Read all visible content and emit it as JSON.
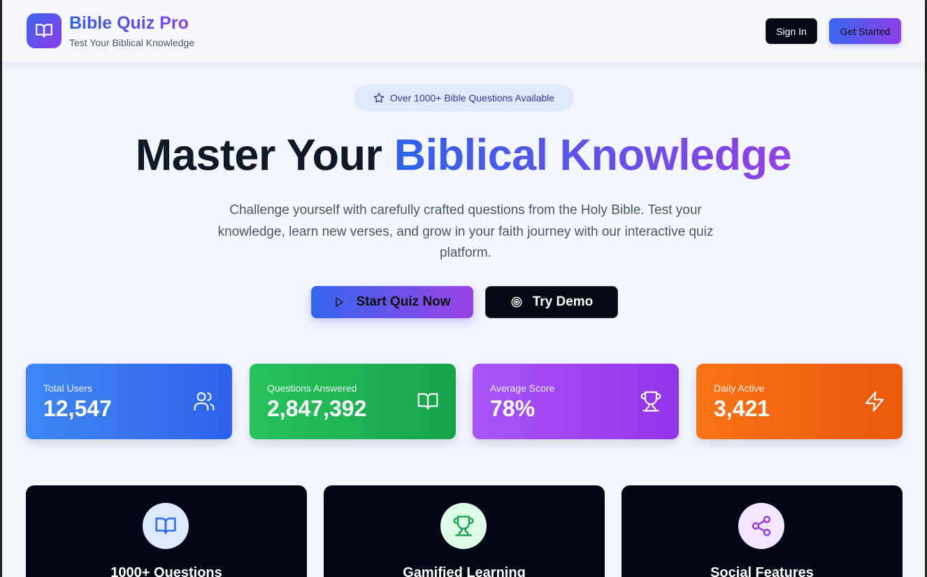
{
  "header": {
    "title": "Bible Quiz Pro",
    "subtitle": "Test Your Biblical Knowledge",
    "logo_icon": "book-open-icon",
    "sign_in_label": "Sign In",
    "get_started_label": "Get Started"
  },
  "hero": {
    "badge_text": "Over 1000+ Bible Questions Available",
    "badge_icon": "star-icon",
    "title_dark": "Master Your",
    "title_gradient": "Biblical Knowledge",
    "description": "Challenge yourself with carefully crafted questions from the Holy Bible. Test your knowledge, learn new verses, and grow in your faith journey with our interactive quiz platform.",
    "start_label": "Start Quiz Now",
    "start_icon": "play-icon",
    "demo_label": "Try Demo",
    "demo_icon": "target-icon"
  },
  "stats": [
    {
      "label": "Total Users",
      "value": "12,547",
      "icon": "users-icon",
      "color": "#3b82f6"
    },
    {
      "label": "Questions Answered",
      "value": "2,847,392",
      "icon": "book-open-icon",
      "color": "#22c55e"
    },
    {
      "label": "Average Score",
      "value": "78%",
      "icon": "trophy-icon",
      "color": "#a855f7"
    },
    {
      "label": "Daily Active",
      "value": "3,421",
      "icon": "zap-icon",
      "color": "#f97316"
    }
  ],
  "features": [
    {
      "title": "1000+ Questions",
      "icon": "book-open-icon",
      "icon_color": "#2563eb"
    },
    {
      "title": "Gamified Learning",
      "icon": "trophy-icon",
      "icon_color": "#16a34a"
    },
    {
      "title": "Social Features",
      "icon": "share-icon",
      "icon_color": "#9333ea"
    }
  ],
  "colors": {
    "accent_blue": "#2f5fe9",
    "accent_purple": "#8a3fe6",
    "dark": "#060913"
  }
}
